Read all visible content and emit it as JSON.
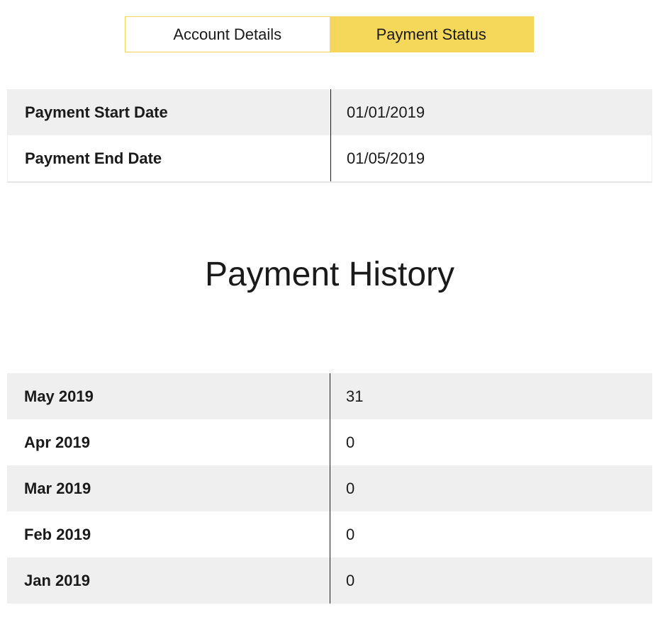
{
  "tabs": [
    {
      "label": "Account Details",
      "active": false
    },
    {
      "label": "Payment Status",
      "active": true
    }
  ],
  "colors": {
    "accent": "#f5d75a",
    "row_shade": "#efefef"
  },
  "payment_dates": [
    {
      "label": "Payment Start Date",
      "value": "01/01/2019"
    },
    {
      "label": "Payment End Date",
      "value": "01/05/2019"
    }
  ],
  "history": {
    "title": "Payment History",
    "rows": [
      {
        "month": "May 2019",
        "value": "31"
      },
      {
        "month": "Apr 2019",
        "value": "0"
      },
      {
        "month": "Mar 2019",
        "value": "0"
      },
      {
        "month": "Feb 2019",
        "value": "0"
      },
      {
        "month": "Jan 2019",
        "value": "0"
      }
    ]
  }
}
